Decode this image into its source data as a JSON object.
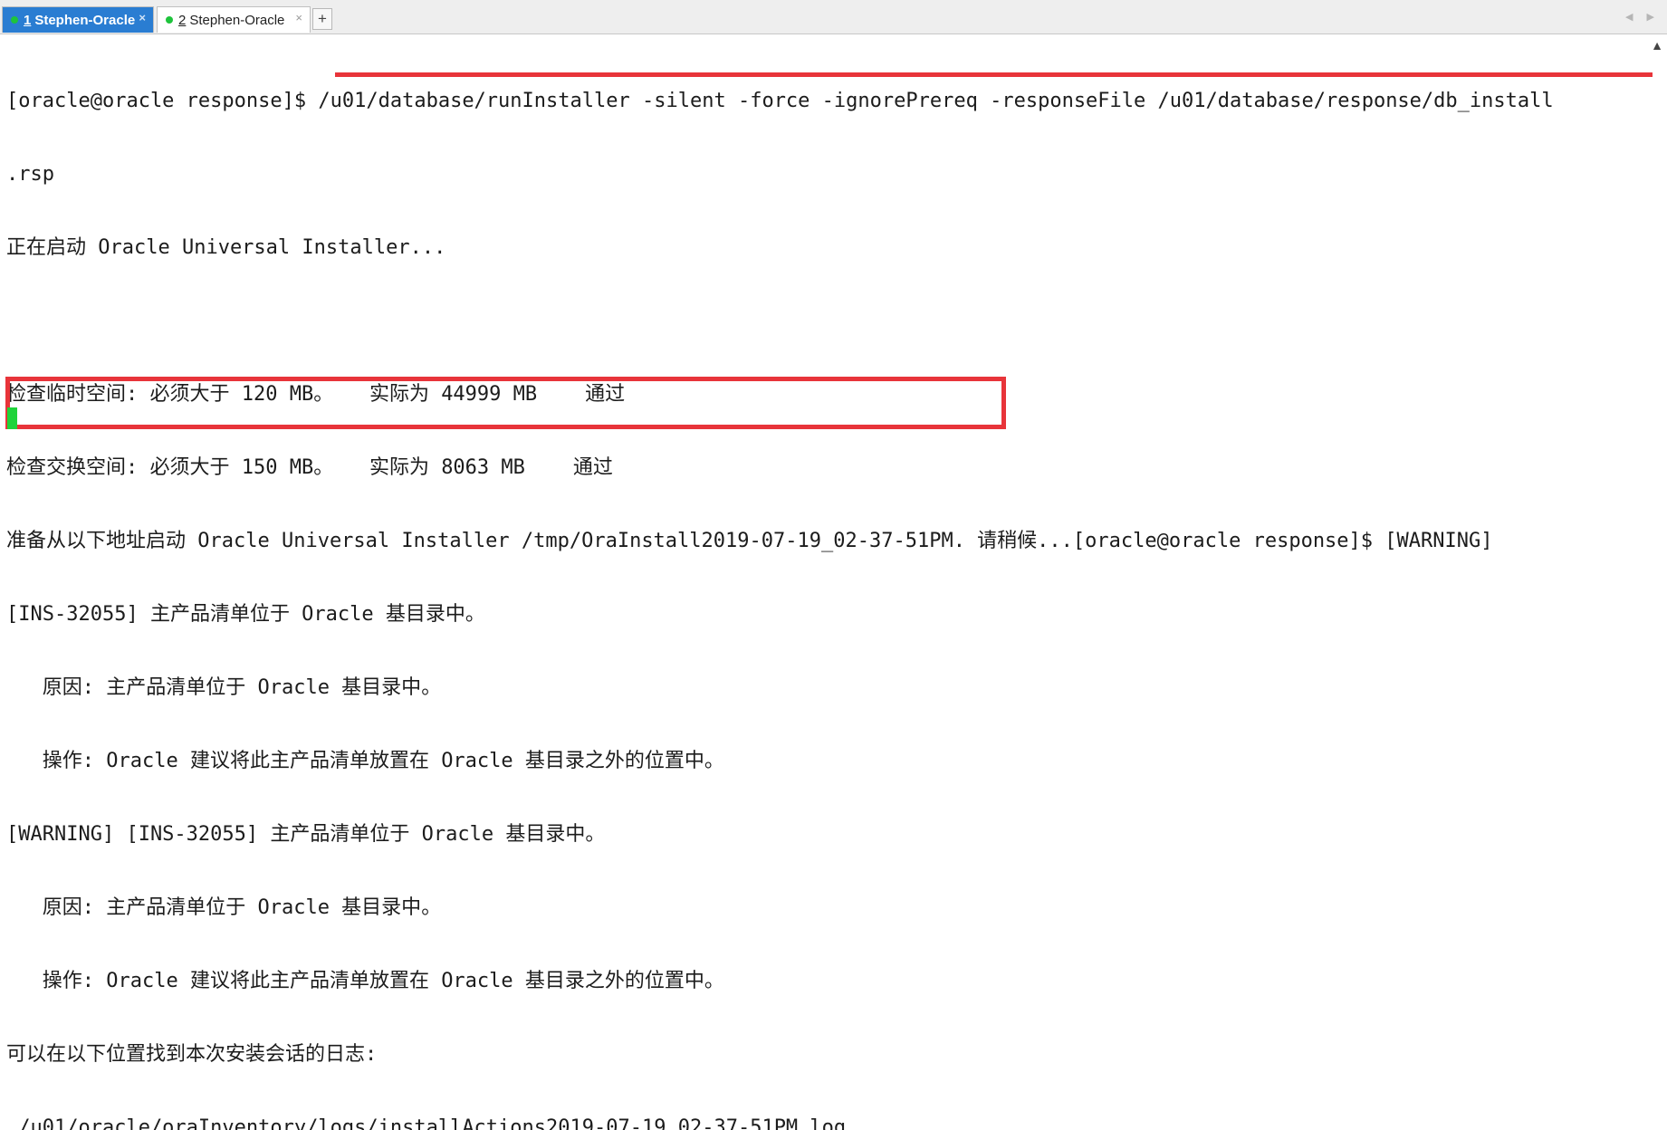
{
  "tabs": [
    {
      "number": "1",
      "label": "Stephen-Oracle",
      "close": "×"
    },
    {
      "number": "2",
      "label": "Stephen-Oracle",
      "close": "×"
    }
  ],
  "add_tab_label": "+",
  "scroll_arrows": "◀ ▶",
  "scroll_up": "▲",
  "terminal": {
    "lines": [
      "[oracle@oracle response]$ /u01/database/runInstaller -silent -force -ignorePrereq -responseFile /u01/database/response/db_install",
      ".rsp",
      "正在启动 Oracle Universal Installer...",
      "",
      "检查临时空间: 必须大于 120 MB。   实际为 44999 MB    通过",
      "检查交换空间: 必须大于 150 MB。   实际为 8063 MB    通过",
      "准备从以下地址启动 Oracle Universal Installer /tmp/OraInstall2019-07-19_02-37-51PM. 请稍候...[oracle@oracle response]$ [WARNING]",
      "[INS-32055] 主产品清单位于 Oracle 基目录中。",
      "   原因: 主产品清单位于 Oracle 基目录中。",
      "   操作: Oracle 建议将此主产品清单放置在 Oracle 基目录之外的位置中。",
      "[WARNING] [INS-32055] 主产品清单位于 Oracle 基目录中。",
      "   原因: 主产品清单位于 Oracle 基目录中。",
      "   操作: Oracle 建议将此主产品清单放置在 Oracle 基目录之外的位置中。",
      "可以在以下位置找到本次安装会话的日志:",
      " /u01/oracle/oraInventory/logs/installActions2019-07-19_02-37-51PM.log"
    ]
  },
  "colors": {
    "active_tab": "#2a7dd2",
    "status_dot": "#1ec43c",
    "highlight": "#e8343a",
    "cursor": "#1fd33a"
  }
}
